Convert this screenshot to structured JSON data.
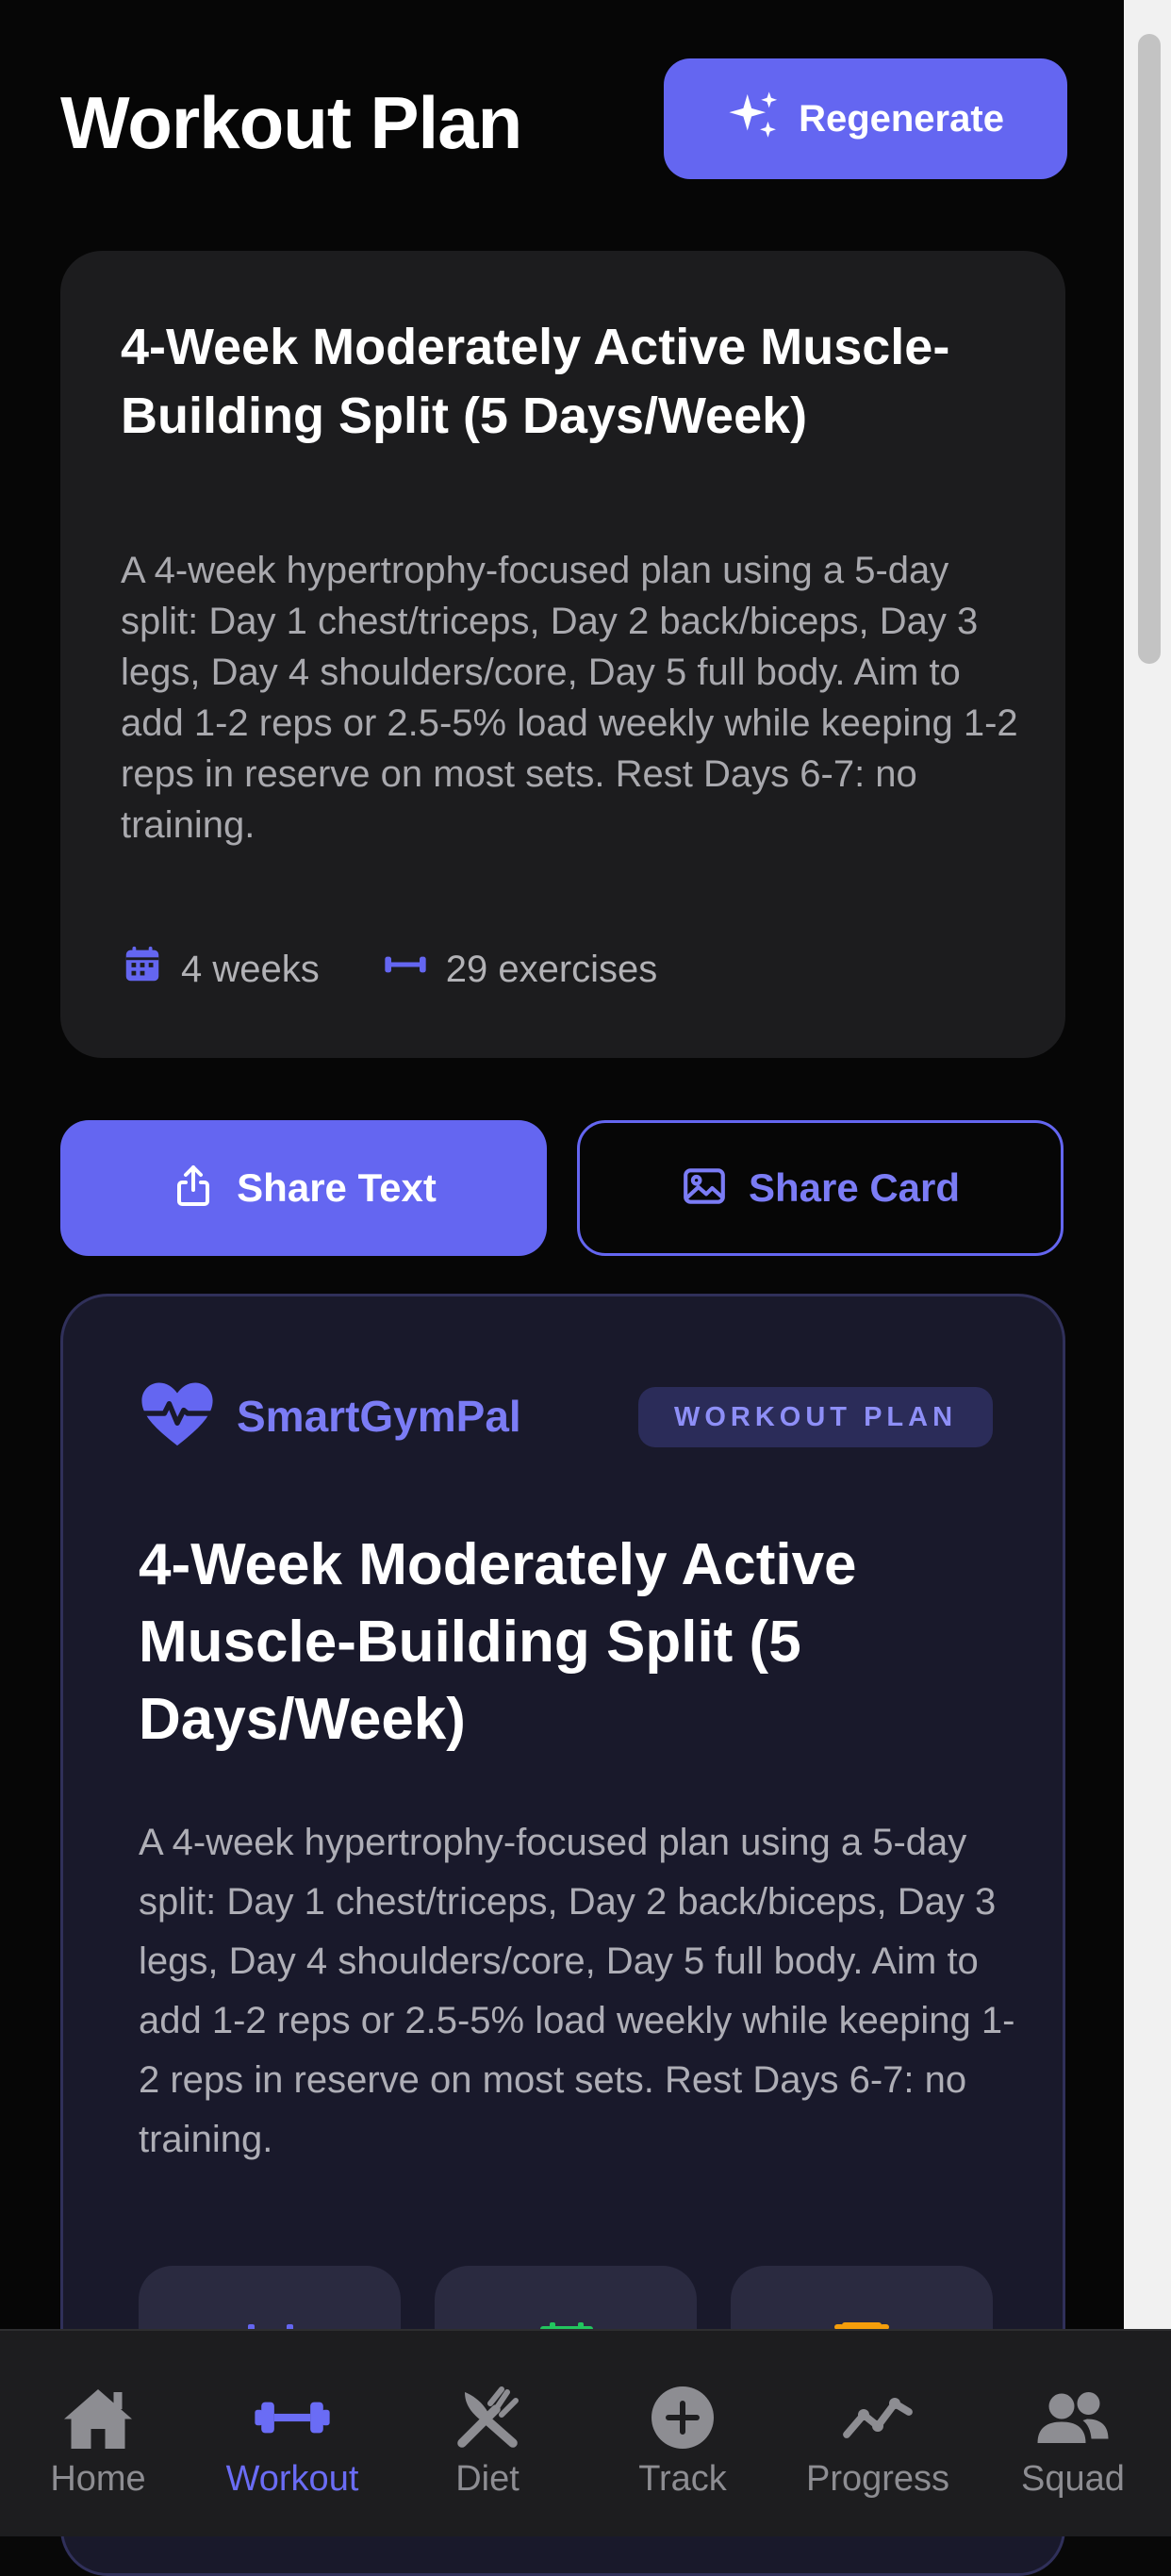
{
  "header": {
    "title": "Workout Plan",
    "regenerate_label": "Regenerate"
  },
  "plan": {
    "title": "4-Week Moderately Active Muscle-Building Split (5 Days/Week)",
    "description": "A 4-week hypertrophy-focused plan using a 5-day split: Day 1 chest/triceps, Day 2 back/biceps, Day 3 legs, Day 4 shoulders/core, Day 5 full body. Aim to add 1-2 reps or 2.5-5% load weekly while keeping 1-2 reps in reserve on most sets. Rest Days 6-7: no training.",
    "duration": "4 weeks",
    "exercise_count": "29 exercises"
  },
  "share": {
    "text_label": "Share Text",
    "card_label": "Share Card"
  },
  "preview": {
    "brand": "SmartGymPal",
    "badge": "WORKOUT PLAN",
    "title": "4-Week Moderately Active Muscle-Building Split (5 Days/Week)",
    "description": "A 4-week hypertrophy-focused plan using a 5-day split: Day 1 chest/triceps, Day 2 back/biceps, Day 3 legs, Day 4 shoulders/core, Day 5 full body. Aim to add 1-2 reps or 2.5-5% load weekly while keeping 1-2 reps in reserve on most sets. Rest Days 6-7: no training."
  },
  "tabs": [
    {
      "label": "Home",
      "icon": "home-icon",
      "active": false
    },
    {
      "label": "Workout",
      "icon": "dumbbell-icon",
      "active": true
    },
    {
      "label": "Diet",
      "icon": "fork-knife-icon",
      "active": false
    },
    {
      "label": "Track",
      "icon": "plus-circle-icon",
      "active": false
    },
    {
      "label": "Progress",
      "icon": "trend-icon",
      "active": false
    },
    {
      "label": "Squad",
      "icon": "people-icon",
      "active": false
    }
  ],
  "colors": {
    "accent": "#6466f1",
    "background": "#060606",
    "card": "#1c1c1e",
    "preview_card": "#19192b",
    "tab_inactive": "#8d8d92"
  }
}
